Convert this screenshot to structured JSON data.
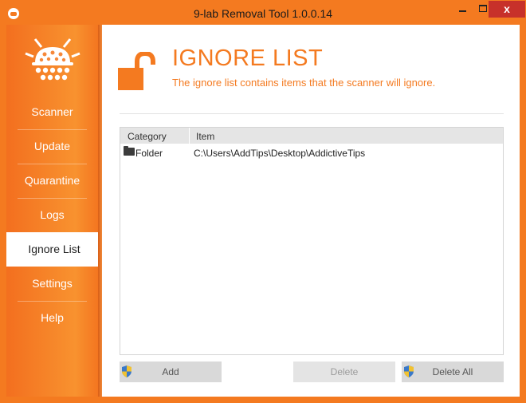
{
  "window": {
    "title": "9-lab Removal Tool 1.0.0.14",
    "close_glyph": "x"
  },
  "sidebar": {
    "items": [
      {
        "label": "Scanner"
      },
      {
        "label": "Update"
      },
      {
        "label": "Quarantine"
      },
      {
        "label": "Logs"
      },
      {
        "label": "Ignore List",
        "active": true
      },
      {
        "label": "Settings"
      },
      {
        "label": "Help"
      }
    ]
  },
  "page": {
    "title": "IGNORE LIST",
    "subtitle": "The ignore list contains items that the scanner will ignore."
  },
  "list": {
    "columns": [
      "Category",
      "Item"
    ],
    "rows": [
      {
        "category": "Folder",
        "item": "C:\\Users\\AddTips\\Desktop\\AddictiveTips",
        "icon": "folder-icon"
      }
    ]
  },
  "buttons": {
    "add": "Add",
    "delete": "Delete",
    "delete_all": "Delete All"
  },
  "colors": {
    "accent": "#f47a20",
    "close": "#c7312a"
  }
}
